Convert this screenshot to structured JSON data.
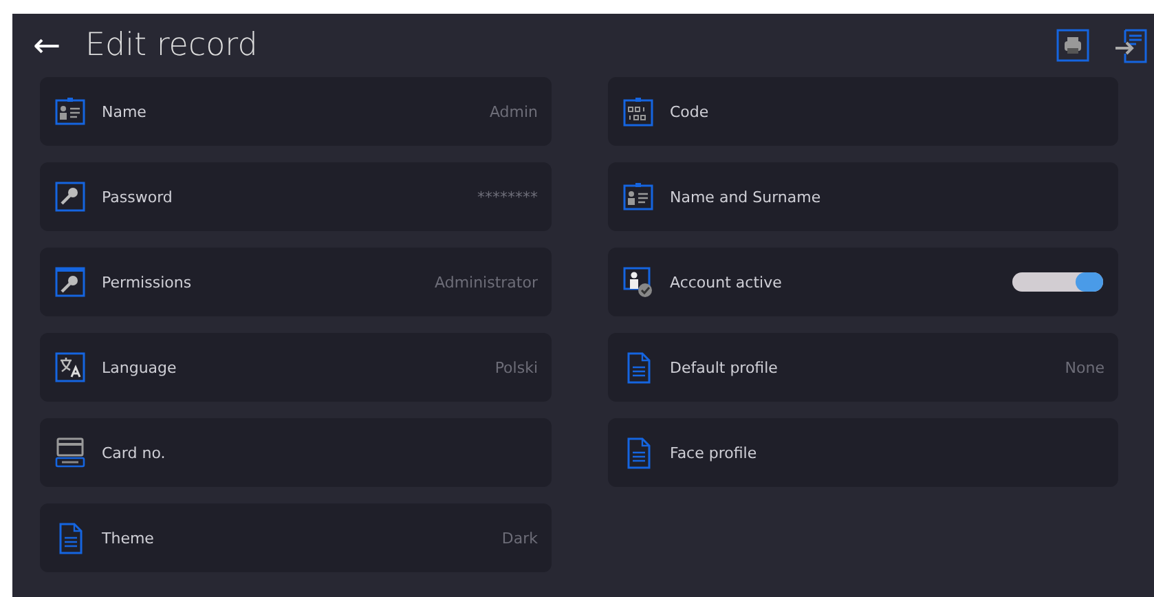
{
  "header": {
    "back": "←",
    "title": "Edit record"
  },
  "left_column": [
    {
      "kind": "value",
      "label": "Name",
      "value": "Admin"
    },
    {
      "kind": "value",
      "label": "Password",
      "value": "********"
    },
    {
      "kind": "value",
      "label": "Permissions",
      "value": "Administrator"
    },
    {
      "kind": "value",
      "label": "Language",
      "value": "Polski"
    },
    {
      "kind": "value",
      "label": "Card no."
    },
    {
      "kind": "value",
      "label": "Theme",
      "value": "Dark"
    }
  ],
  "right_column": [
    {
      "kind": "value",
      "label": "Code"
    },
    {
      "kind": "value",
      "label": "Name and Surname"
    },
    {
      "kind": "toggle",
      "label": "Account active",
      "on": true
    },
    {
      "kind": "value",
      "label": "Default profile",
      "value": "None"
    },
    {
      "kind": "value",
      "label": "Face profile"
    }
  ]
}
